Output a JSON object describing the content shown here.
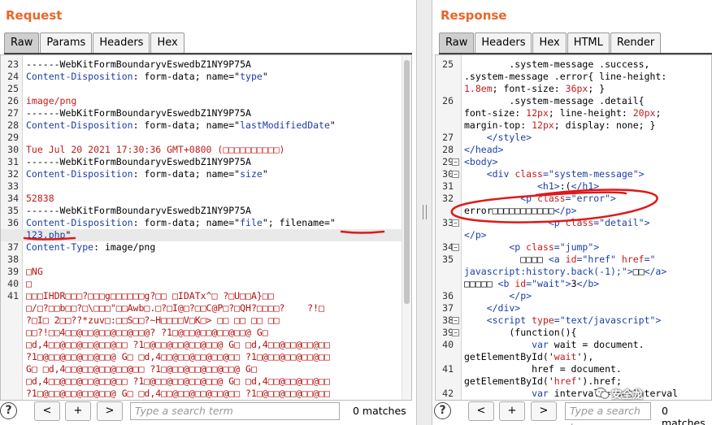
{
  "request": {
    "title": "Request",
    "tabs": [
      {
        "label": "Raw",
        "active": true
      },
      {
        "label": "Params",
        "active": false
      },
      {
        "label": "Headers",
        "active": false
      },
      {
        "label": "Hex",
        "active": false
      }
    ],
    "lines": [
      {
        "n": "23",
        "segs": [
          {
            "t": "------WebKitFormBoundaryvEswedbZ1NY9P75A",
            "c": "blk"
          }
        ]
      },
      {
        "n": "24",
        "segs": [
          {
            "t": "Content-Disposition",
            "c": "blu"
          },
          {
            "t": ": form-data; name=\"",
            "c": "blk"
          },
          {
            "t": "type",
            "c": "blu"
          },
          {
            "t": "\"",
            "c": "blk"
          }
        ]
      },
      {
        "n": "25",
        "segs": []
      },
      {
        "n": "26",
        "segs": [
          {
            "t": "image/png",
            "c": "red"
          }
        ]
      },
      {
        "n": "27",
        "segs": [
          {
            "t": "------WebKitFormBoundaryvEswedbZ1NY9P75A",
            "c": "blk"
          }
        ]
      },
      {
        "n": "28",
        "segs": [
          {
            "t": "Content-Disposition",
            "c": "blu"
          },
          {
            "t": ": form-data; name=\"",
            "c": "blk"
          },
          {
            "t": "lastModifiedDate",
            "c": "blu"
          },
          {
            "t": "\"",
            "c": "blk"
          }
        ]
      },
      {
        "n": "29",
        "segs": []
      },
      {
        "n": "30",
        "segs": [
          {
            "t": "Tue Jul 20 2021 17:30:36 GMT+0800 (□□□□□□□□□□)",
            "c": "red"
          }
        ]
      },
      {
        "n": "31",
        "segs": [
          {
            "t": "------WebKitFormBoundaryvEswedbZ1NY9P75A",
            "c": "blk"
          }
        ]
      },
      {
        "n": "32",
        "segs": [
          {
            "t": "Content-Disposition",
            "c": "blu"
          },
          {
            "t": ": form-data; name=\"",
            "c": "blk"
          },
          {
            "t": "size",
            "c": "blu"
          },
          {
            "t": "\"",
            "c": "blk"
          }
        ]
      },
      {
        "n": "33",
        "segs": []
      },
      {
        "n": "34",
        "segs": [
          {
            "t": "52838",
            "c": "red"
          }
        ]
      },
      {
        "n": "35",
        "segs": [
          {
            "t": "------WebKitFormBoundaryvEswedbZ1NY9P75A",
            "c": "blk"
          }
        ]
      },
      {
        "n": "36",
        "segs": [
          {
            "t": "Content-Disposition",
            "c": "blu"
          },
          {
            "t": ": form-data; name=\"",
            "c": "blk"
          },
          {
            "t": "file",
            "c": "blu"
          },
          {
            "t": "\"; filename=\"",
            "c": "blk"
          }
        ]
      },
      {
        "n": "",
        "hl": true,
        "segs": [
          {
            "t": "123.php",
            "c": "blu"
          },
          {
            "t": "\"",
            "c": "blk"
          }
        ]
      },
      {
        "n": "37",
        "segs": [
          {
            "t": "Content-Type",
            "c": "blu"
          },
          {
            "t": ": image/png",
            "c": "blk"
          }
        ]
      },
      {
        "n": "38",
        "segs": []
      },
      {
        "n": "39",
        "segs": [
          {
            "t": "□NG",
            "c": "bin"
          }
        ]
      },
      {
        "n": "40",
        "segs": [
          {
            "t": "□",
            "c": "bin"
          }
        ]
      },
      {
        "n": "41",
        "segs": [
          {
            "t": "□□□IHDR□□□?□□□g□□□□□□g?□□ □IDATx^□ ?□U□□A}□□",
            "c": "bin"
          }
        ]
      },
      {
        "n": "",
        "segs": [
          {
            "t": "□/□?□□b□□?□\\□□□\"□□Awb□.□?□I@□?□□C@P□?□QH?□□□□?    ?!□",
            "c": "bin"
          }
        ]
      },
      {
        "n": "",
        "segs": [
          {
            "t": "?□I□ 2□□??*zuv□:□□S□□?~H□□□□V□K□> □□ □□ □□ □□",
            "c": "bin"
          }
        ]
      },
      {
        "n": "",
        "segs": [
          {
            "t": "□□?!□□4□□@□□@□□@□□@□□@? ?1□@□□@□□@□□@□□@ G□",
            "c": "bin"
          }
        ]
      },
      {
        "n": "",
        "segs": [
          {
            "t": "□d,4□□@□□@□□@□□@□□ ?1□@□□@□□@□□@□□@ G□ □d,4□□@□□@□□@□□",
            "c": "bin"
          }
        ]
      },
      {
        "n": "",
        "segs": [
          {
            "t": "?1□@□□@□□@□□@□□@ G□ □d,4□□@□□@□□@□□@□□ ?1□@□□@□□@□□@□□",
            "c": "bin"
          }
        ]
      },
      {
        "n": "",
        "segs": [
          {
            "t": "G□ □d,4□□@□□@□□@□□@□□ ?1□@□□@□□@□□@□□@ G□",
            "c": "bin"
          }
        ]
      },
      {
        "n": "",
        "segs": [
          {
            "t": "□d,4□□@□□@□□@□□@□□ ?1□@□□@□□@□□@□□@ G□ □d,4□□@□□@□□@□□",
            "c": "bin"
          }
        ]
      },
      {
        "n": "",
        "segs": [
          {
            "t": "?1□@□□@□□@□□@□□@ G□ □d,4□□@□□@□□@□□@□□ ?1□@□□@□□@□□@□□",
            "c": "bin"
          }
        ]
      }
    ],
    "search_placeholder": "Type a search term",
    "matches": "0 matches",
    "help_label": "?",
    "prev_label": "<",
    "add_label": "+",
    "next_label": ">"
  },
  "response": {
    "title": "Response",
    "tabs": [
      {
        "label": "Raw",
        "active": true
      },
      {
        "label": "Headers",
        "active": false
      },
      {
        "label": "Hex",
        "active": false
      },
      {
        "label": "HTML",
        "active": false
      },
      {
        "label": "Render",
        "active": false
      }
    ],
    "lines": [
      {
        "n": "25",
        "segs": [
          {
            "t": "        .system-message .success,",
            "c": "blk"
          }
        ]
      },
      {
        "n": "",
        "segs": [
          {
            "t": ".system-message .error{ line-height:",
            "c": "blk"
          }
        ]
      },
      {
        "n": "",
        "segs": [
          {
            "t": "1.8em",
            "c": "red"
          },
          {
            "t": "; font-size: ",
            "c": "blk"
          },
          {
            "t": "36px",
            "c": "red"
          },
          {
            "t": "; }",
            "c": "blk"
          }
        ]
      },
      {
        "n": "26",
        "segs": [
          {
            "t": "        .system-message .detail{",
            "c": "blk"
          }
        ]
      },
      {
        "n": "",
        "segs": [
          {
            "t": "font-size: ",
            "c": "blk"
          },
          {
            "t": "12px",
            "c": "red"
          },
          {
            "t": "; line-height: ",
            "c": "blk"
          },
          {
            "t": "20px",
            "c": "red"
          },
          {
            "t": ";",
            "c": "blk"
          }
        ]
      },
      {
        "n": "",
        "segs": [
          {
            "t": "margin-top: ",
            "c": "blk"
          },
          {
            "t": "12px",
            "c": "red"
          },
          {
            "t": "; display: none; }",
            "c": "blk"
          }
        ]
      },
      {
        "n": "27",
        "segs": [
          {
            "t": "    </style>",
            "c": "blu"
          }
        ]
      },
      {
        "n": "28",
        "segs": [
          {
            "t": "</head>",
            "c": "blu"
          }
        ]
      },
      {
        "n": "29",
        "fold": true,
        "segs": [
          {
            "t": "<body>",
            "c": "blu"
          }
        ]
      },
      {
        "n": "30",
        "fold": true,
        "segs": [
          {
            "t": "    <div ",
            "c": "blu"
          },
          {
            "t": "class",
            "c": "red"
          },
          {
            "t": "=\"",
            "c": "blu"
          },
          {
            "t": "system-message",
            "c": "blu"
          },
          {
            "t": "\">",
            "c": "blu"
          }
        ]
      },
      {
        "n": "31",
        "segs": [
          {
            "t": "             <h1>",
            "c": "blu"
          },
          {
            "t": ":(",
            "c": "blk"
          },
          {
            "t": "</h1>",
            "c": "blu"
          }
        ]
      },
      {
        "n": "32",
        "segs": [
          {
            "t": "          <p ",
            "c": "blu"
          },
          {
            "t": "class",
            "c": "red"
          },
          {
            "t": "=\"",
            "c": "blu"
          },
          {
            "t": "error",
            "c": "blu"
          },
          {
            "t": "\">",
            "c": "blu"
          }
        ]
      },
      {
        "n": "",
        "segs": [
          {
            "t": "error□□□□□□□□□□□",
            "c": "blk"
          },
          {
            "t": "</p>",
            "c": "blu"
          }
        ]
      },
      {
        "n": "33",
        "fold": true,
        "segs": [
          {
            "t": "               <p ",
            "c": "blu"
          },
          {
            "t": "class",
            "c": "red"
          },
          {
            "t": "=\"",
            "c": "blu"
          },
          {
            "t": "detail",
            "c": "blu"
          },
          {
            "t": "\">",
            "c": "blu"
          }
        ]
      },
      {
        "n": "",
        "segs": [
          {
            "t": "</p>",
            "c": "blu"
          }
        ]
      },
      {
        "n": "34",
        "fold": true,
        "segs": [
          {
            "t": "        <p ",
            "c": "blu"
          },
          {
            "t": "class",
            "c": "red"
          },
          {
            "t": "=\"",
            "c": "blu"
          },
          {
            "t": "jump",
            "c": "blu"
          },
          {
            "t": "\">",
            "c": "blu"
          }
        ]
      },
      {
        "n": "35",
        "segs": [
          {
            "t": "          □□□□ ",
            "c": "blk"
          },
          {
            "t": "<a ",
            "c": "blu"
          },
          {
            "t": "id",
            "c": "red"
          },
          {
            "t": "=\"href\" ",
            "c": "blu"
          },
          {
            "t": "href",
            "c": "red"
          },
          {
            "t": "=\"",
            "c": "blu"
          }
        ]
      },
      {
        "n": "",
        "segs": [
          {
            "t": "javascript:history.back(-1);\">",
            "c": "blu"
          },
          {
            "t": "□□",
            "c": "blk"
          },
          {
            "t": "</a>",
            "c": "blu"
          }
        ]
      },
      {
        "n": "",
        "segs": [
          {
            "t": "□□□□□ ",
            "c": "blk"
          },
          {
            "t": "<b ",
            "c": "blu"
          },
          {
            "t": "id",
            "c": "red"
          },
          {
            "t": "=\"wait\">",
            "c": "blu"
          },
          {
            "t": "3",
            "c": "blk"
          },
          {
            "t": "</b>",
            "c": "blu"
          }
        ]
      },
      {
        "n": "36",
        "segs": [
          {
            "t": "        </p>",
            "c": "blu"
          }
        ]
      },
      {
        "n": "37",
        "segs": [
          {
            "t": "    </div>",
            "c": "blu"
          }
        ]
      },
      {
        "n": "38",
        "fold": true,
        "segs": [
          {
            "t": "    <script ",
            "c": "blu"
          },
          {
            "t": "type",
            "c": "red"
          },
          {
            "t": "=\"text/javascript\">",
            "c": "blu"
          }
        ]
      },
      {
        "n": "39",
        "fold": true,
        "segs": [
          {
            "t": "        (function(){",
            "c": "blk"
          }
        ]
      },
      {
        "n": "40",
        "segs": [
          {
            "t": "            var",
            "c": "blu"
          },
          {
            "t": " wait = document.",
            "c": "blk"
          }
        ]
      },
      {
        "n": "",
        "segs": [
          {
            "t": "getElementById('",
            "c": "blk"
          },
          {
            "t": "wait",
            "c": "red"
          },
          {
            "t": "'),",
            "c": "blk"
          }
        ]
      },
      {
        "n": "41",
        "segs": [
          {
            "t": "            href = document.",
            "c": "blk"
          }
        ]
      },
      {
        "n": "",
        "segs": [
          {
            "t": "getElementById('",
            "c": "blk"
          },
          {
            "t": "href",
            "c": "red"
          },
          {
            "t": "').href;",
            "c": "blk"
          }
        ]
      },
      {
        "n": "42",
        "segs": [
          {
            "t": "            var",
            "c": "blu"
          },
          {
            "t": " interval = setInterval",
            "c": "blk"
          }
        ]
      }
    ],
    "search_placeholder": "Type a search te",
    "matches": "0 matches",
    "help_label": "?",
    "prev_label": "<",
    "add_label": "+",
    "next_label": ">"
  },
  "watermark": "安全龙",
  "colors": {
    "title": "#e8662a",
    "keyword_blue": "#1b3ea8",
    "value_red": "#c41b1b",
    "annotation_red": "#e01818"
  }
}
